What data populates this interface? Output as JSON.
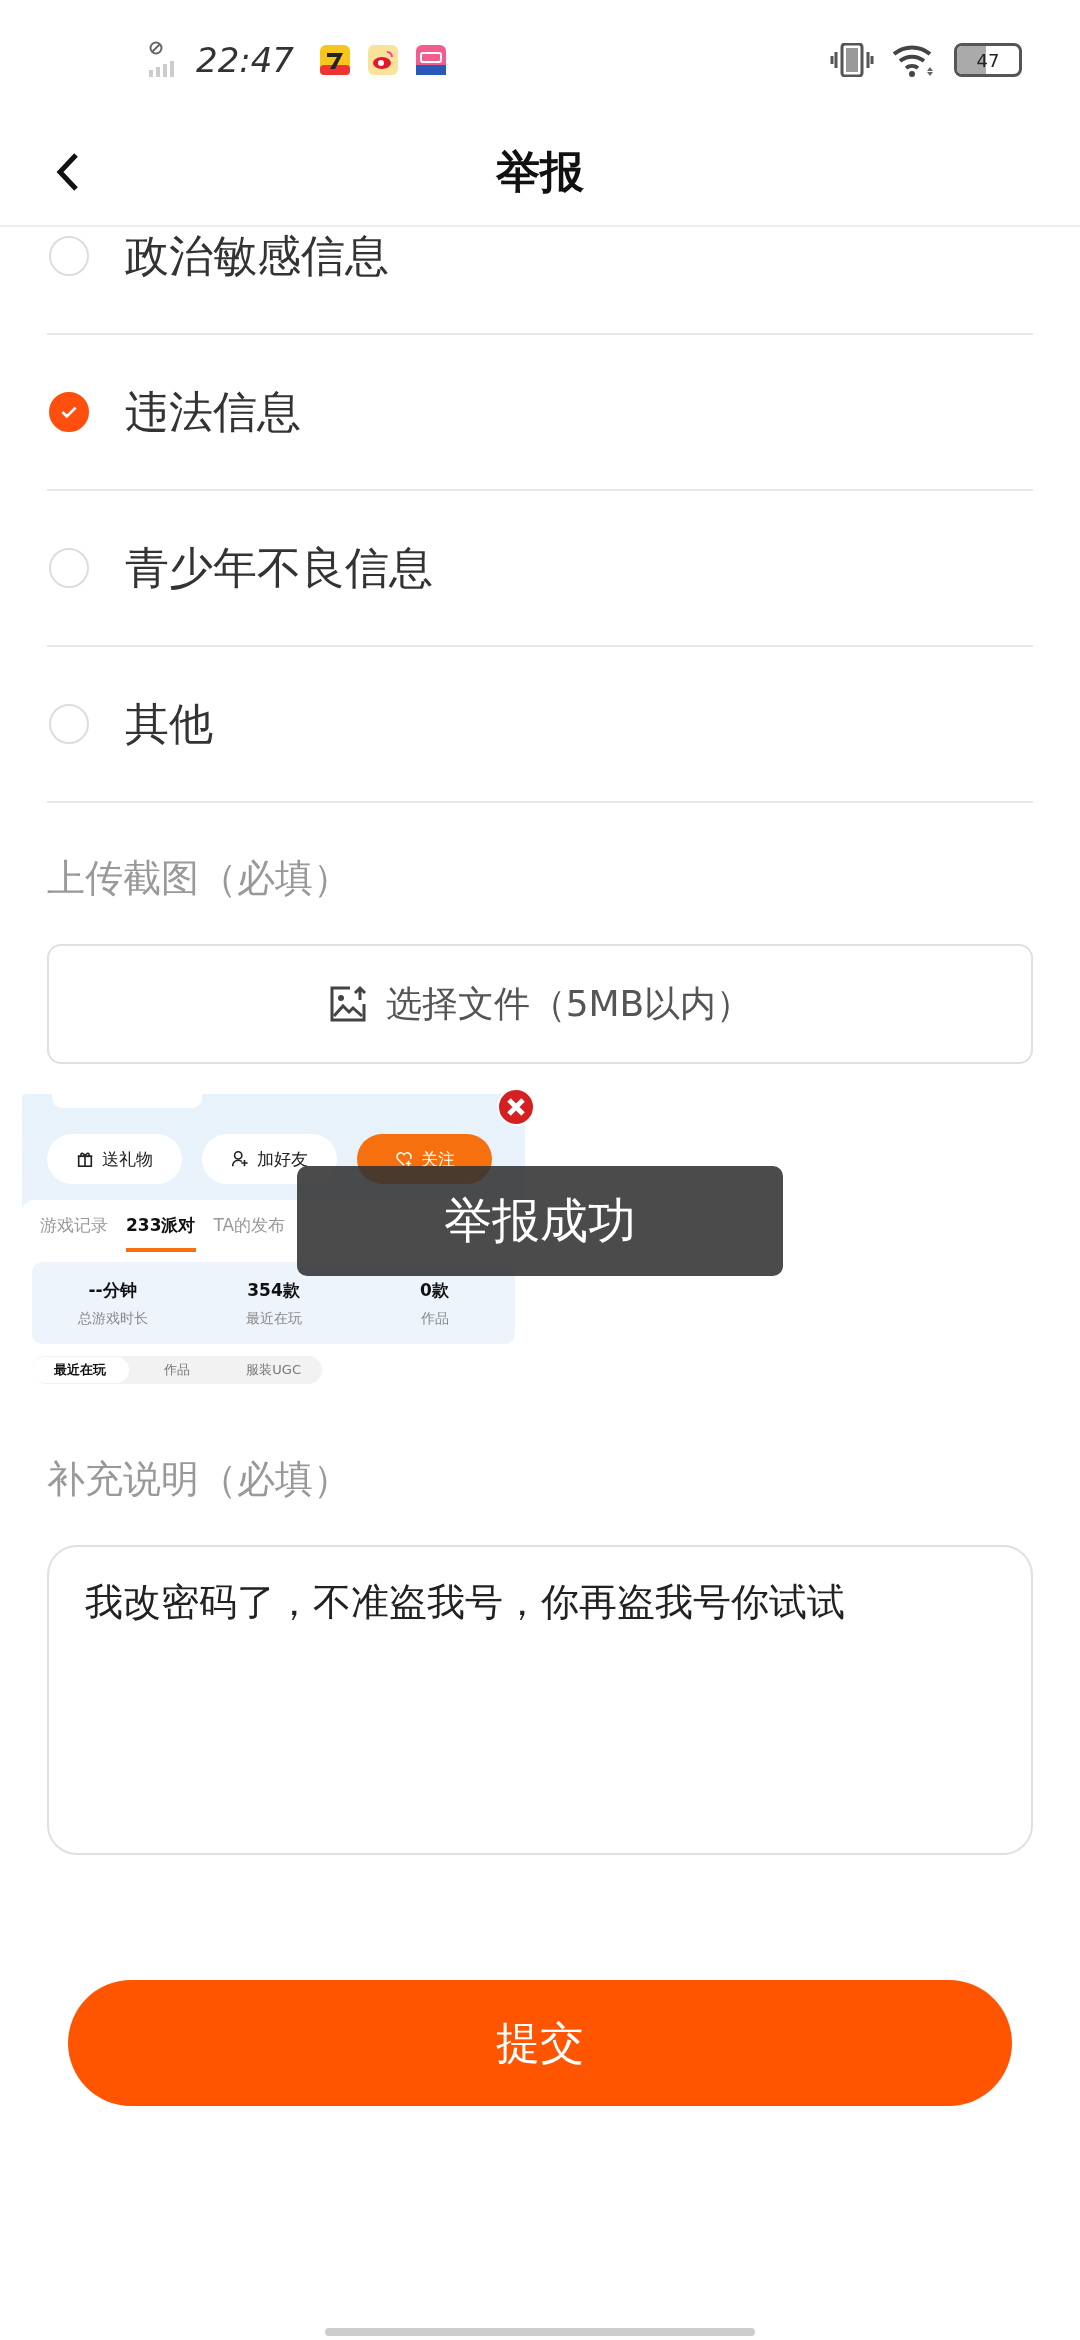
{
  "status_bar": {
    "time": "22:47",
    "battery": "47"
  },
  "header": {
    "title": "举报"
  },
  "options": [
    {
      "label": "政治敏感信息",
      "selected": false
    },
    {
      "label": "违法信息",
      "selected": true
    },
    {
      "label": "青少年不良信息",
      "selected": false
    },
    {
      "label": "其他",
      "selected": false
    }
  ],
  "upload": {
    "label": "上传截图（必填）",
    "button": "选择文件（5MB以内）"
  },
  "screenshot": {
    "buttons": [
      {
        "label": "送礼物",
        "kind": "gift"
      },
      {
        "label": "加好友",
        "kind": "add-friend"
      },
      {
        "label": "关注",
        "kind": "follow"
      }
    ],
    "tabs": [
      {
        "label": "游戏记录",
        "selected": false
      },
      {
        "label": "233派对",
        "selected": true
      },
      {
        "label": "TA的发布",
        "selected": false
      }
    ],
    "stats": [
      {
        "value": "--分钟",
        "label": "总游戏时长"
      },
      {
        "value": "354款",
        "label": "最近在玩"
      },
      {
        "value": "0款",
        "label": "作品"
      }
    ],
    "subtabs": [
      {
        "label": "最近在玩",
        "selected": true
      },
      {
        "label": "作品",
        "selected": false
      },
      {
        "label": "服装UGC",
        "selected": false
      }
    ]
  },
  "toast": "举报成功",
  "note": {
    "label": "补充说明（必填）",
    "value": "我改密码了，不准盗我号，你再盗我号你试试"
  },
  "submit": "提交"
}
